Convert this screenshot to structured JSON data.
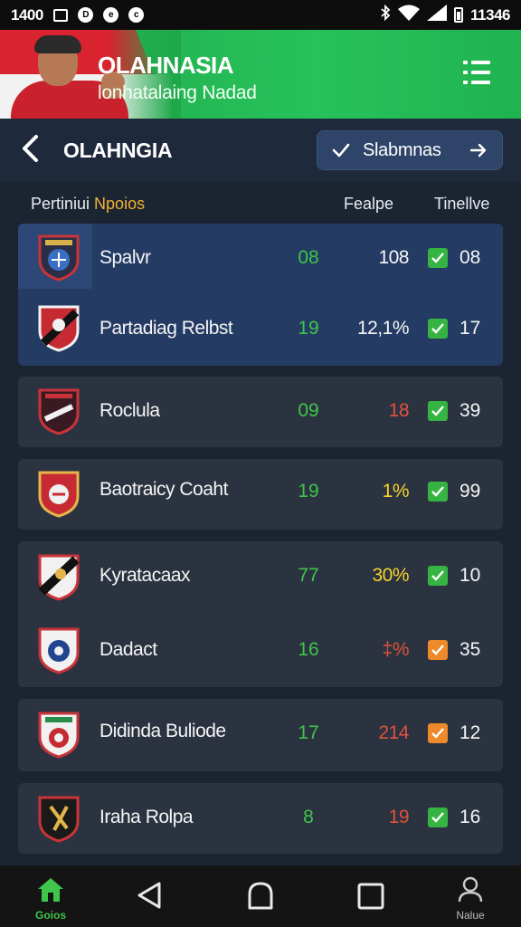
{
  "status_bar": {
    "time": "1400",
    "clock": "11346"
  },
  "banner": {
    "title": "OLAHNASIA",
    "subtitle": "lonhatalaing Nadad"
  },
  "header": {
    "title": "OLAHNGIA",
    "action_label": "Slabmnas"
  },
  "columns": {
    "col1_a": "Pertiniui",
    "col1_b": "Npoios",
    "col2": "Fealpe",
    "col3": "Tinellve"
  },
  "colors": {
    "green": "#3ec54a",
    "red": "#e0513d",
    "yellow": "#f4d32a",
    "orange": "#ef8a2a",
    "blue_card": "#243b63",
    "grey_card": "#2c3340"
  },
  "rows": [
    {
      "team": "Spalvr",
      "v1": "08",
      "v2": "108",
      "v2_color": "white",
      "check": "green",
      "v3": "08"
    },
    {
      "team": "Partadiag Relbst",
      "v1": "19",
      "v2": "12,1%",
      "v2_color": "white",
      "check": "green",
      "v3": "17"
    },
    {
      "team": "Roclula",
      "v1": "09",
      "v2": "18",
      "v2_color": "red",
      "check": "green",
      "v3": "39"
    },
    {
      "team": "Baotraicy Coaht",
      "v1": "19",
      "v2": "1%",
      "v2_color": "yellow",
      "check": "green",
      "v3": "99"
    },
    {
      "team": "Kyratacaax",
      "v1": "77",
      "v2": "30%",
      "v2_color": "yellow",
      "check": "green",
      "v3": "10"
    },
    {
      "team": "Dadact",
      "v1": "16",
      "v2": "‡%",
      "v2_color": "red",
      "check": "orange",
      "v3": "35"
    },
    {
      "team": "Didinda Buliode",
      "v1": "17",
      "v2": "214",
      "v2_color": "red",
      "check": "orange",
      "v3": "12"
    },
    {
      "team": "Iraha Rolpa",
      "v1": "8",
      "v2": "19",
      "v2_color": "red",
      "check": "green",
      "v3": "16"
    }
  ],
  "bottom_nav": {
    "home_label": "Goios",
    "profile_label": "Nalue"
  }
}
